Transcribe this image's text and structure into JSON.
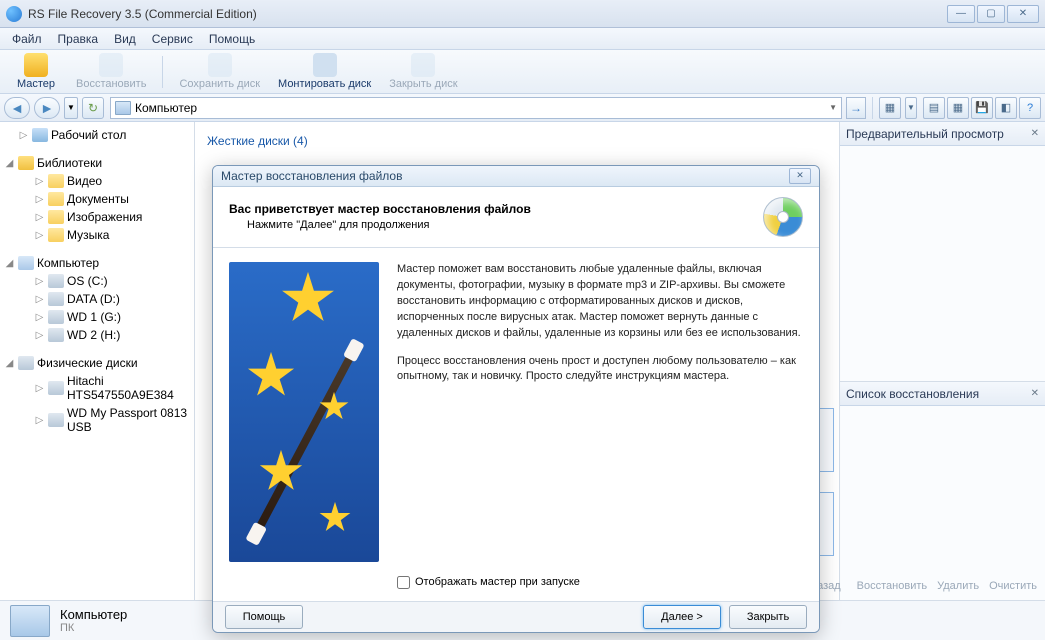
{
  "window": {
    "title": "RS File Recovery 3.5 (Commercial Edition)"
  },
  "menu": {
    "file": "Файл",
    "edit": "Правка",
    "view": "Вид",
    "service": "Сервис",
    "help": "Помощь"
  },
  "toolbar": {
    "wizard": "Мастер",
    "recover": "Восстановить",
    "save_disk": "Сохранить диск",
    "mount_disk": "Монтировать диск",
    "close_disk": "Закрыть диск"
  },
  "address": {
    "location": "Компьютер"
  },
  "tree": {
    "desktop": "Рабочий стол",
    "libraries": "Библиотеки",
    "video": "Видео",
    "documents": "Документы",
    "images": "Изображения",
    "music": "Музыка",
    "computer": "Компьютер",
    "os_c": "OS (C:)",
    "data_d": "DATA (D:)",
    "wd1_g": "WD 1 (G:)",
    "wd2_h": "WD 2 (H:)",
    "physical": "Физические диски",
    "hitachi": "Hitachi HTS547550A9E384",
    "passport": "WD My Passport 0813 USB"
  },
  "center": {
    "hard_disks": "Жесткие диски (4)"
  },
  "rightpane": {
    "preview": "Предварительный просмотр",
    "recovery_list": "Список восстановления"
  },
  "actions": {
    "back": "Назад",
    "recover": "Восстановить",
    "delete": "Удалить",
    "clear": "Очистить"
  },
  "status": {
    "l1": "Компьютер",
    "l2": "ПК"
  },
  "wizard": {
    "title": "Мастер восстановления файлов",
    "heading": "Вас приветствует мастер восстановления файлов",
    "subheading": "Нажмите \"Далее\" для продолжения",
    "para1": "Мастер поможет вам восстановить любые удаленные файлы, включая документы, фотографии, музыку в формате mp3 и ZIP-архивы. Вы сможете восстановить информацию с отформатированных дисков и дисков, испорченных после вирусных атак. Мастер поможет вернуть данные с удаленных дисков и файлы, удаленные из корзины или без ее использования.",
    "para2": "Процесс восстановления очень прост и доступен любому пользователю – как опытному, так и новичку. Просто следуйте инструкциям мастера.",
    "checkbox": "Отображать мастер при запуске",
    "help": "Помощь",
    "next": "Далее >",
    "close": "Закрыть"
  }
}
